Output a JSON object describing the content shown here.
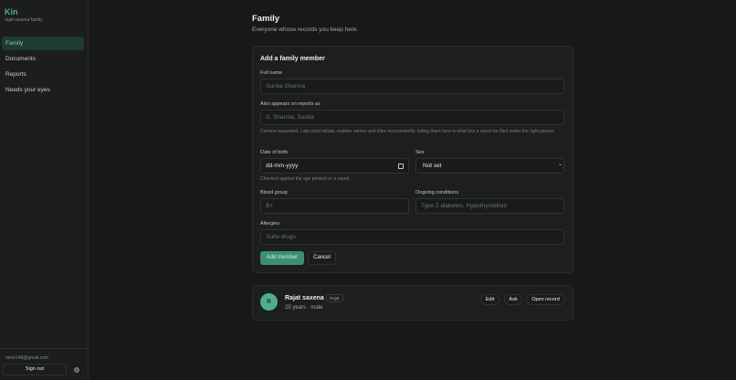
{
  "sidebar": {
    "brand": "Kin",
    "family_name": "rajat saxena family",
    "items": [
      {
        "label": "Family",
        "active": true
      },
      {
        "label": "Documents",
        "active": false
      },
      {
        "label": "Reports",
        "active": false
      },
      {
        "label": "Needs your eyes",
        "active": false
      }
    ],
    "email": "rsmx148@gmail.com",
    "signout_label": "Sign out"
  },
  "header": {
    "title": "Family",
    "subtitle": "Everyone whose records you keep here."
  },
  "form": {
    "title": "Add a family member",
    "full_name": {
      "label": "Full name",
      "placeholder": "Sunita Sharma"
    },
    "aliases": {
      "label": "Also appears on reports as",
      "placeholder": "S. Sharma, Sunita",
      "hint": "Comma separated. Labs print initials, maiden names and titles inconsistently; listing them here is what lets a report be filed under the right person."
    },
    "dob": {
      "label": "Date of birth",
      "value": "dd-mm-yyyy",
      "hint": "Checked against the age printed on a report."
    },
    "sex": {
      "label": "Sex",
      "value": "Not set"
    },
    "blood_group": {
      "label": "Blood group",
      "placeholder": "B+"
    },
    "conditions": {
      "label": "Ongoing conditions",
      "placeholder": "Type 2 diabetes, Hypothyroidism"
    },
    "allergies": {
      "label": "Allergies",
      "placeholder": "Sulfa drugs"
    },
    "submit_label": "Add member",
    "cancel_label": "Cancel"
  },
  "member": {
    "initial": "R",
    "name": "Rajat saxena",
    "tag": "Rajat",
    "meta": "25 years · male",
    "actions": [
      "Edit",
      "Ask",
      "Open record"
    ]
  }
}
